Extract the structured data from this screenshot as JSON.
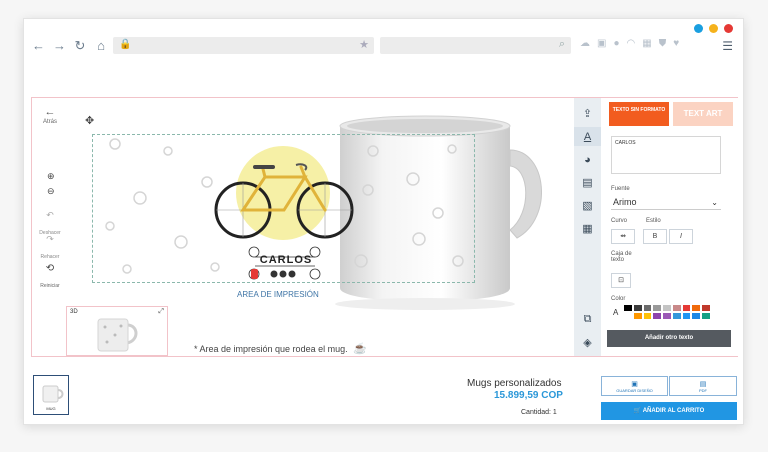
{
  "browser": {
    "window_dots": [
      "#1a9fe0",
      "#f5b21c",
      "#e53935"
    ],
    "nav_icons": [
      "back-icon",
      "forward-icon",
      "reload-icon",
      "home-icon"
    ],
    "url": "",
    "search_placeholder": ""
  },
  "left_tools": {
    "back_label": "Atrás",
    "undo_label": "Deshacer",
    "redo_label": "Rehacer",
    "reset_label": "Reiniciar"
  },
  "design": {
    "name_text": "CARLOS",
    "area_label": "AREA DE IMPRESIÓN",
    "note": "* Area de impresión que rodea el mug.",
    "preview_label": "3D"
  },
  "panel": {
    "plain_text_button": "TEXTO SIN FORMATO",
    "text_art_button": "TEXT ART",
    "textarea_value": "CARLOS",
    "font_label": "Fuente",
    "font_value": "Arimo",
    "curve_label": "Curvo",
    "style_label": "Estilo",
    "bold_label": "B",
    "italic_label": "I",
    "textbox_label": "Caja de texto",
    "color_label": "Color",
    "color_sample": "A",
    "add_text_button": "Añadir otro texto",
    "swatch_colors": [
      "#000000",
      "#3c3c3c",
      "#6b6b6b",
      "#9a9a9a",
      "#c4c4c4",
      "#c98989",
      "#e53935",
      "#f06a0c",
      "#c0392b",
      "#ffffff",
      "#ff9800",
      "#ffc107",
      "#8e44ad",
      "#9b59b6",
      "#3498db",
      "#2196f3",
      "#1e88e5",
      "#16a085"
    ]
  },
  "bottom": {
    "thumb_label": "MUG",
    "product_title": "Mugs personalizados",
    "price": "15.899,59 COP",
    "quantity": "Cantidad: 1",
    "save_label": "GUARDAR DISEÑO",
    "pdf_label": "PDF",
    "cart_label": "AÑADIR AL CARRITO"
  },
  "colors": {
    "accent_blue": "#2196e3",
    "orange": "#f25c1f"
  }
}
